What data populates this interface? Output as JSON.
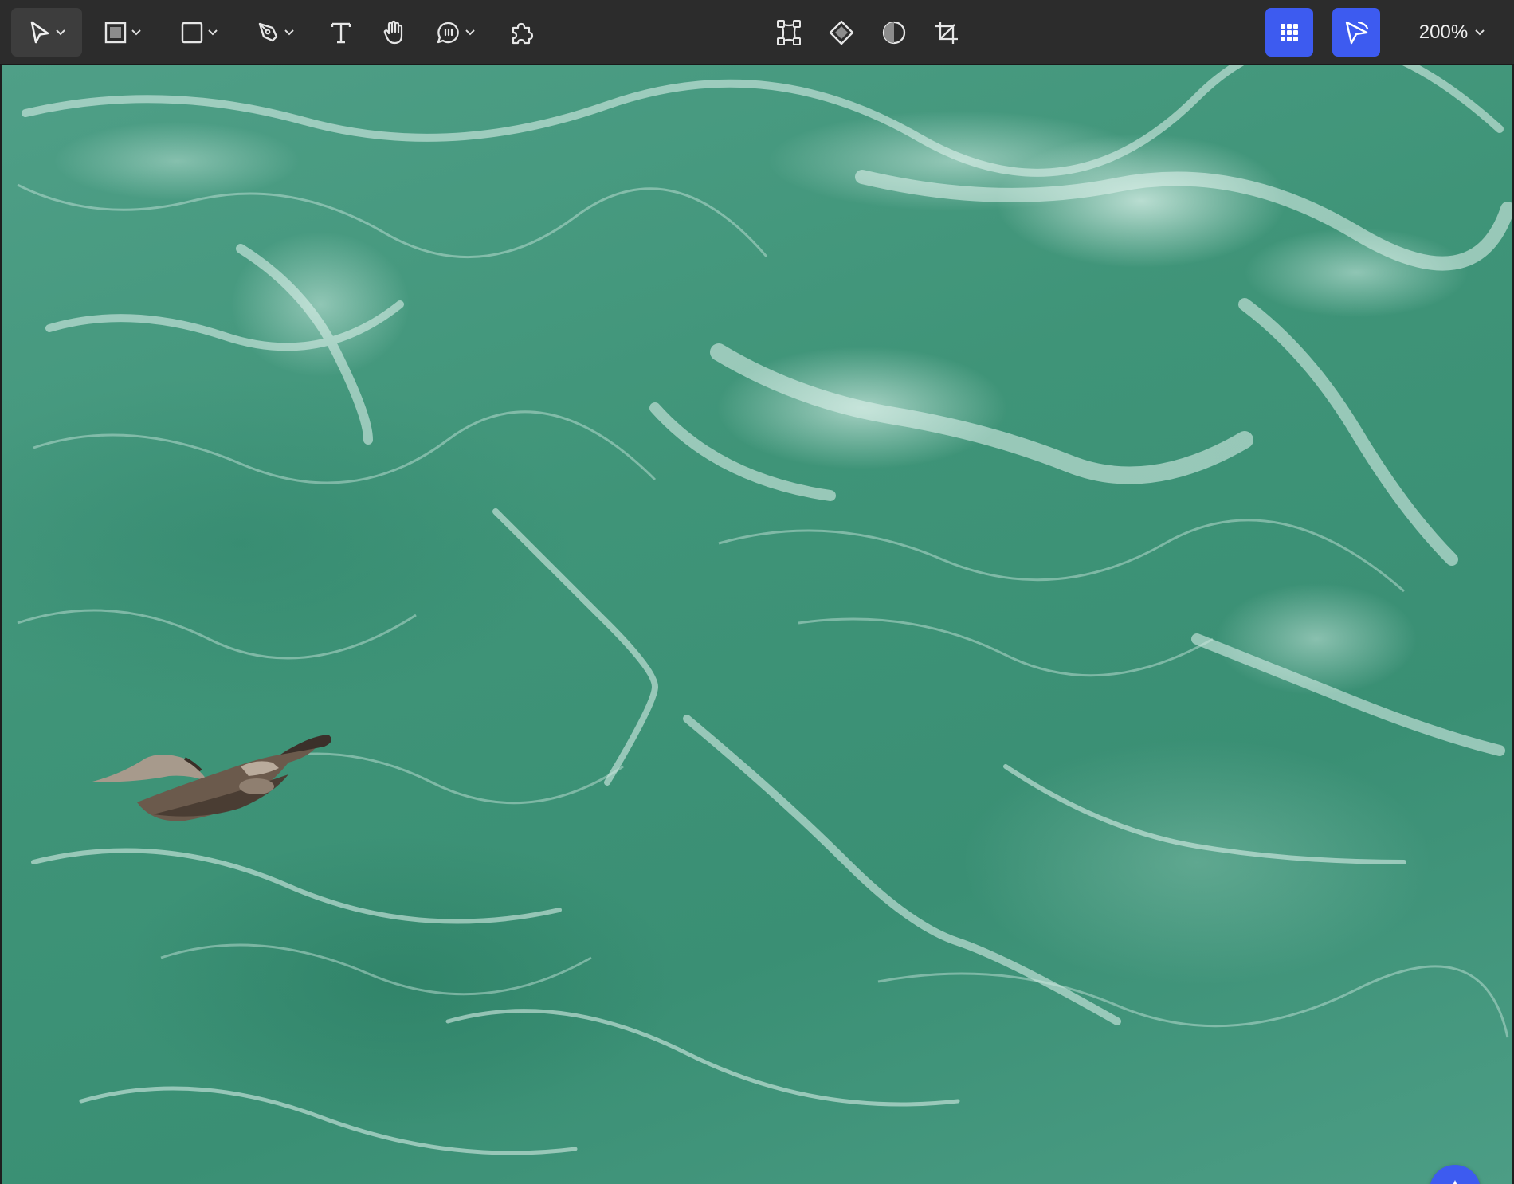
{
  "toolbar": {
    "left_tools": [
      {
        "name": "move-tool",
        "icon": "cursor-arrow-icon",
        "has_dropdown": true,
        "active": true
      },
      {
        "name": "frame-tool",
        "icon": "frame-icon",
        "has_dropdown": true
      },
      {
        "name": "shape-tool",
        "icon": "rectangle-icon",
        "has_dropdown": true
      },
      {
        "name": "pen-tool",
        "icon": "pen-icon",
        "has_dropdown": true
      },
      {
        "name": "text-tool",
        "icon": "text-icon",
        "has_dropdown": false
      },
      {
        "name": "hand-tool",
        "icon": "hand-icon",
        "has_dropdown": false
      },
      {
        "name": "comment-tool",
        "icon": "comment-icon",
        "has_dropdown": true
      },
      {
        "name": "plugins-tool",
        "icon": "puzzle-icon",
        "has_dropdown": false
      }
    ],
    "center_tools": [
      {
        "name": "transform-tool",
        "icon": "transform-icon"
      },
      {
        "name": "component-tool",
        "icon": "component-diamond-icon"
      },
      {
        "name": "mask-tool",
        "icon": "half-circle-icon"
      },
      {
        "name": "crop-tool",
        "icon": "crop-icon"
      }
    ],
    "right_tools": [
      {
        "name": "apps-button",
        "icon": "grid-icon",
        "color": "#3d5bf0"
      },
      {
        "name": "present-button",
        "icon": "play-cursor-icon",
        "color": "#3d5bf0"
      }
    ],
    "zoom": "200%"
  },
  "canvas": {
    "image_subject": "seagull-over-turquoise-water-icon",
    "water_color": "#3f9478",
    "foam_color": "#dff2ec"
  },
  "fab": {
    "icon": "star-icon",
    "color": "#3d5bf0"
  }
}
